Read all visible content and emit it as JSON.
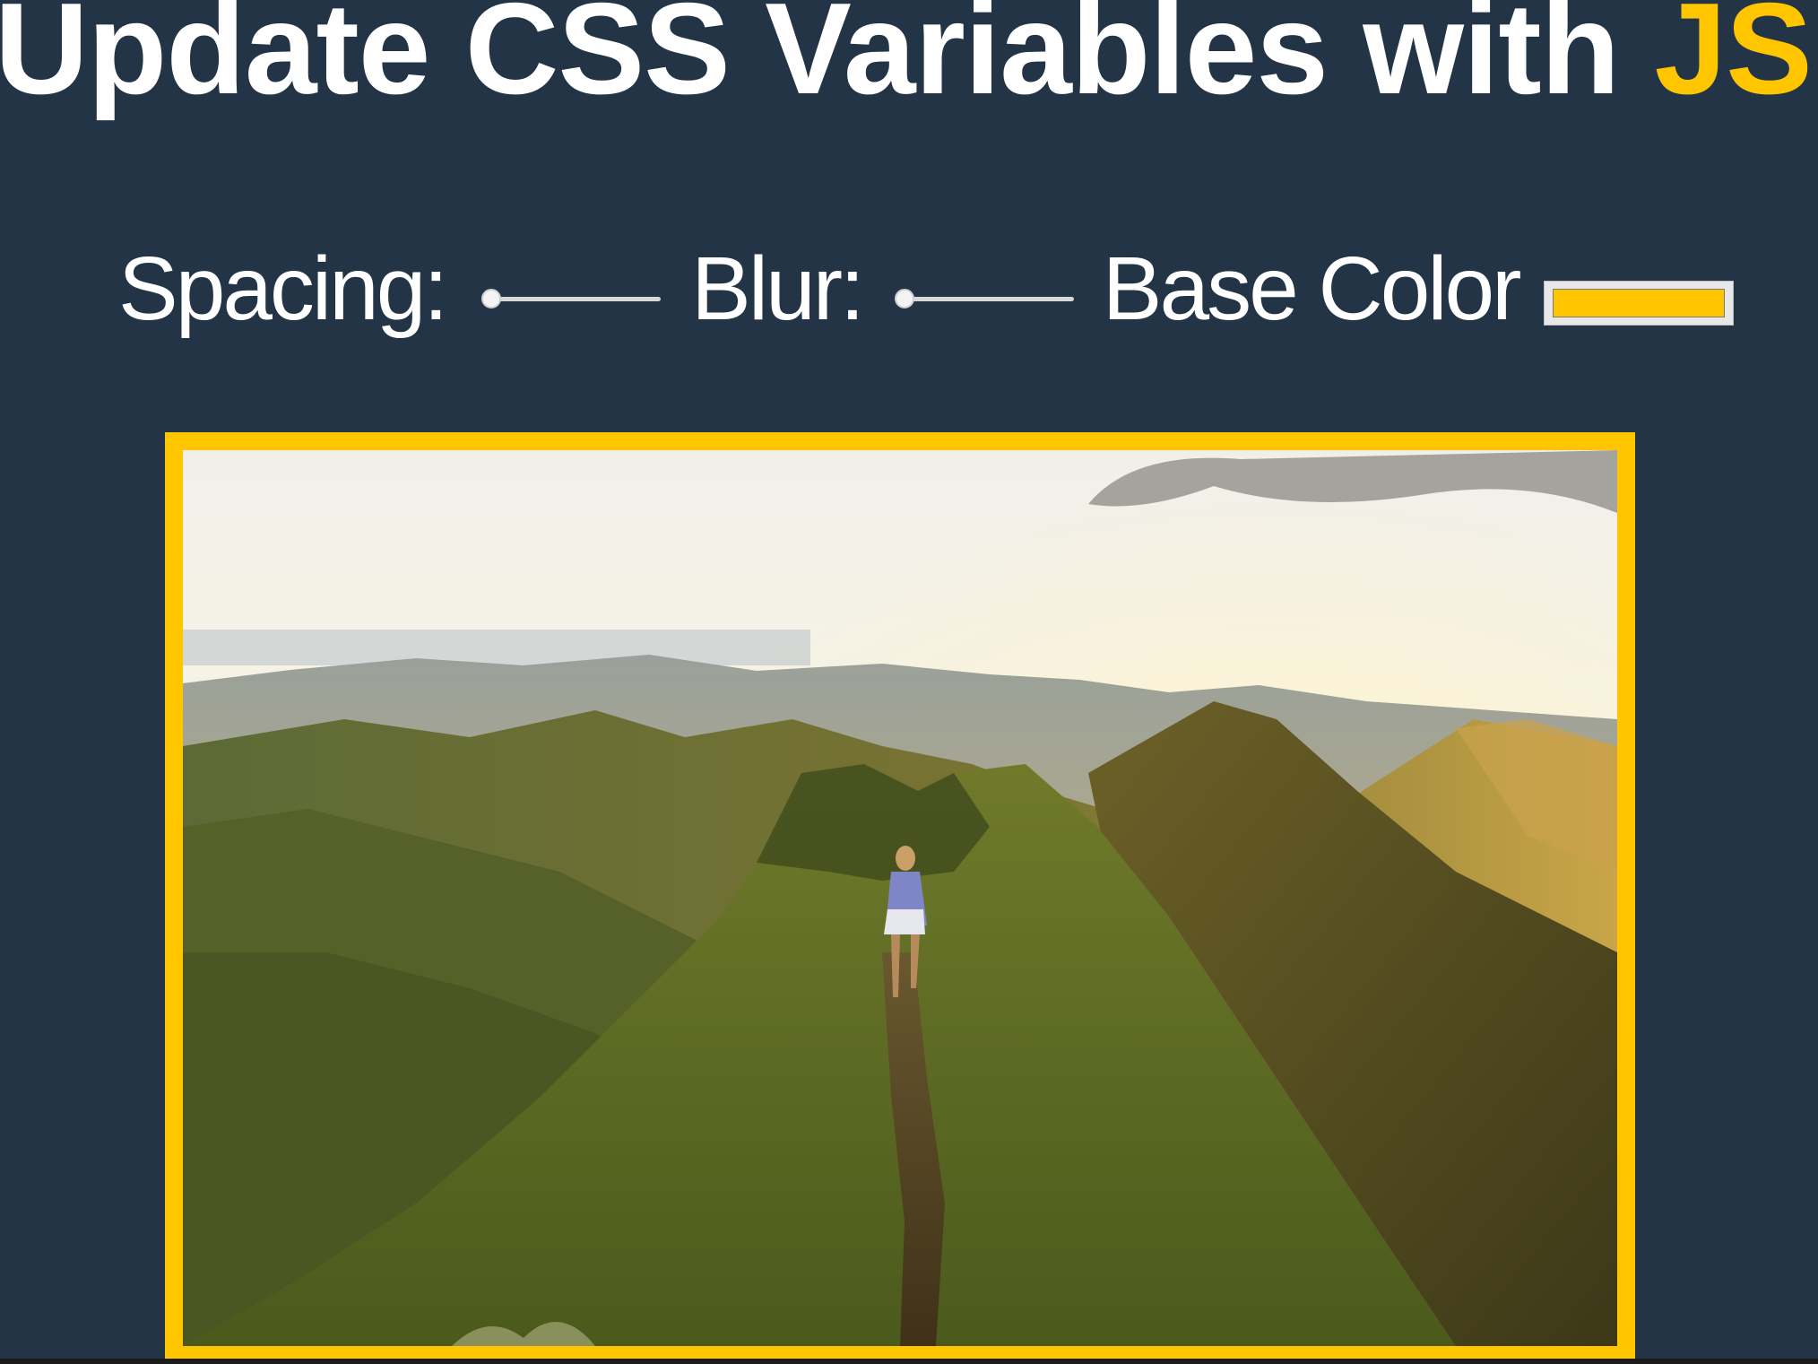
{
  "title": {
    "text": "Update CSS Variables with ",
    "highlight": "JS"
  },
  "controls": {
    "spacing": {
      "label": "Spacing:",
      "value": 10,
      "min": 10,
      "max": 200
    },
    "blur": {
      "label": "Blur:",
      "value": 0,
      "min": 0,
      "max": 25
    },
    "base_color": {
      "label": "Base Color",
      "value": "#ffc600"
    }
  },
  "colors": {
    "background": "#243447",
    "text": "#ffffff",
    "accent": "#ffc600"
  },
  "image": {
    "description_icon": "mountain-ridge-photo"
  }
}
